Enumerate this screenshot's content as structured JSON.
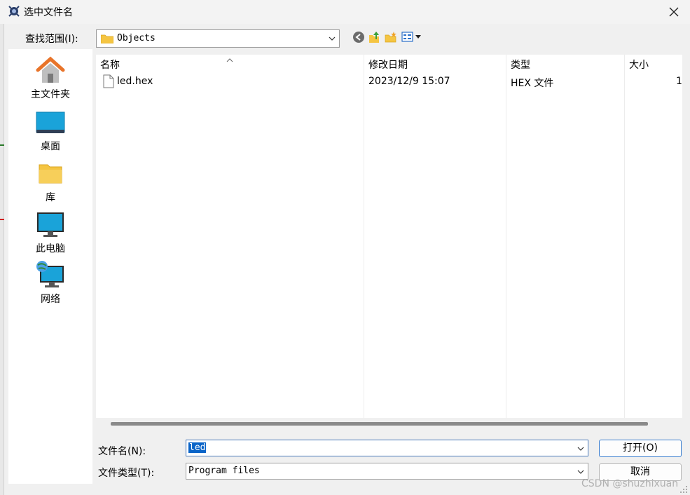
{
  "window": {
    "title": "选中文件名"
  },
  "lookin": {
    "label": "查找范围(I):",
    "value": "Objects"
  },
  "sidebar": {
    "items": [
      {
        "label": "主文件夹",
        "icon": "home-icon"
      },
      {
        "label": "桌面",
        "icon": "desktop-icon"
      },
      {
        "label": "库",
        "icon": "library-folder-icon"
      },
      {
        "label": "此电脑",
        "icon": "computer-icon"
      },
      {
        "label": "网络",
        "icon": "network-icon"
      }
    ]
  },
  "filelist": {
    "columns": [
      "名称",
      "修改日期",
      "类型",
      "大小"
    ],
    "rows": [
      {
        "name": "led.hex",
        "modified": "2023/12/9 15:07",
        "type": "HEX 文件",
        "size": "1"
      }
    ]
  },
  "bottom": {
    "filename_label": "文件名(N):",
    "filename_value": "led",
    "filetype_label": "文件类型(T):",
    "filetype_value": "Program files",
    "open_label": "打开(O)",
    "cancel_label": "取消"
  },
  "watermark": "CSDN @shuzhixuan",
  "colors": {
    "accent": "#0a64c8",
    "folder": "#f5c542",
    "monitor": "#1aa3d9"
  }
}
